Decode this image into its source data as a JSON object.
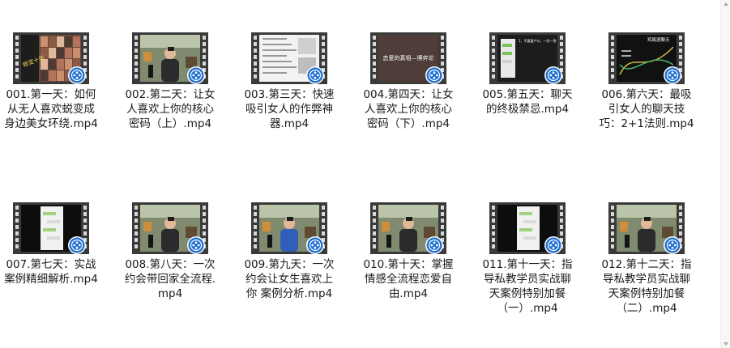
{
  "files": [
    {
      "name": "001.第一天：如何从无人喜欢蜕变成身边美女环绕.mp4",
      "thumb_text": "蜕变十年",
      "scene": "collage",
      "icon": "video-file-icon"
    },
    {
      "name": "002.第二天：让女人喜欢上你的核心密码（上）.mp4",
      "thumb_text": "",
      "scene": "studio",
      "icon": "video-file-icon"
    },
    {
      "name": "003.第三天：快速吸引女人的作弊神器.mp4",
      "thumb_text": "",
      "scene": "document",
      "icon": "video-file-icon"
    },
    {
      "name": "004.第四天：让女人喜欢上你的核心密码（下）.mp4",
      "thumb_text": "恋爱的真相—博弈论",
      "scene": "dark-title",
      "icon": "video-file-icon"
    },
    {
      "name": "005.第五天：聊天的终极禁忌.mp4",
      "thumb_text": "1、不要窗户口，一问一答",
      "scene": "chat-slide",
      "icon": "video-file-icon"
    },
    {
      "name": "006.第六天：最吸引女人的聊天技巧：2+1法则.mp4",
      "thumb_text": "鸡尾酒聊天",
      "scene": "wave-slide",
      "icon": "video-file-icon"
    },
    {
      "name": "007.第七天：实战案例精细解析.mp4",
      "thumb_text": "",
      "scene": "phone-chat",
      "icon": "video-file-icon"
    },
    {
      "name": "008.第八天：一次约会带回家全流程.mp4",
      "thumb_text": "",
      "scene": "studio",
      "icon": "video-file-icon"
    },
    {
      "name": "009.第九天：一次约会让女生喜欢上你 案例分析.mp4",
      "thumb_text": "",
      "scene": "studio-blue",
      "icon": "video-file-icon"
    },
    {
      "name": "010.第十天：掌握情感全流程恋爱自由.mp4",
      "thumb_text": "",
      "scene": "studio",
      "icon": "video-file-icon"
    },
    {
      "name": "011.第十一天：指导私教学员实战聊天案例特别加餐（一）.mp4",
      "thumb_text": "",
      "scene": "phone-chat",
      "icon": "video-file-icon"
    },
    {
      "name": "012.第十二天：指导私教学员实战聊天案例特别加餐（二）.mp4",
      "thumb_text": "",
      "scene": "studio",
      "icon": "video-file-icon"
    }
  ],
  "colors": {
    "film_strip": "#3a3a3a",
    "sprocket": "#d8d8d8",
    "player_badge": "#1f6fd1",
    "player_badge_ring": "#ffffff",
    "label_text": "#1a1a1a"
  }
}
